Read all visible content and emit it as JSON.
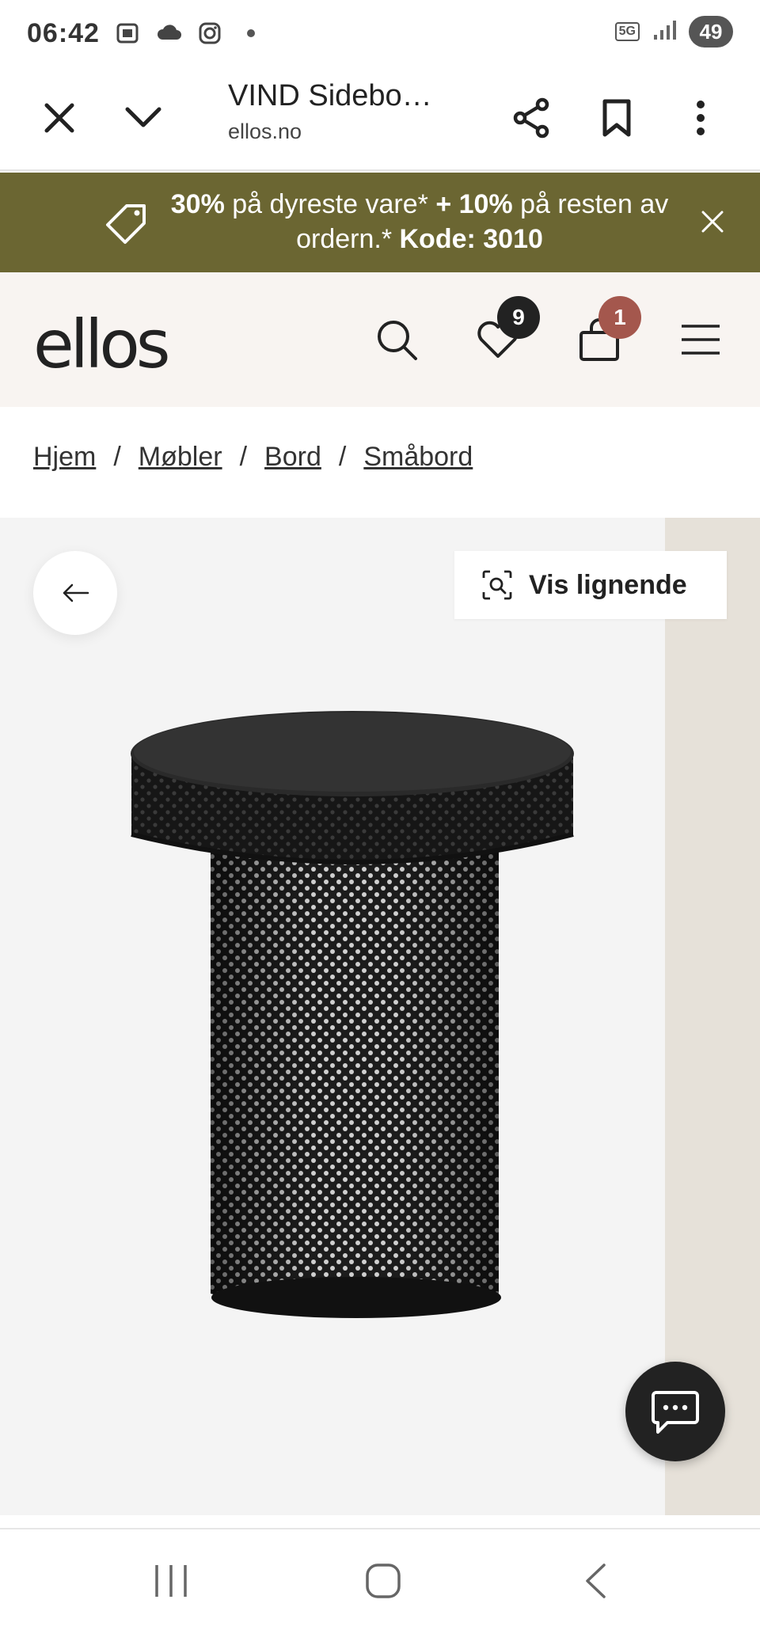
{
  "status_bar": {
    "time": "06:42",
    "network": "5G",
    "battery": "49"
  },
  "browser": {
    "page_title": "VIND Sidebo…",
    "url": "ellos.no"
  },
  "promo": {
    "part1_bold": "30%",
    "part1": " på dyreste vare* ",
    "part2_bold": "+ 10%",
    "part2": " på resten av ordern.* ",
    "code_label": "Kode: 3010"
  },
  "header": {
    "logo": "ellos",
    "wishlist_count": "9",
    "cart_count": "1",
    "colors": {
      "header_bg": "#f8f4f1",
      "promo_bg": "#6b6632",
      "cart_badge": "#a4574d",
      "wishlist_badge": "#222222"
    }
  },
  "breadcrumb": {
    "items": [
      {
        "label": "Hjem"
      },
      {
        "label": "Møbler"
      },
      {
        "label": "Bord"
      },
      {
        "label": "Småbord"
      }
    ],
    "separator": "/"
  },
  "gallery": {
    "similar_label": "Vis lignende"
  }
}
